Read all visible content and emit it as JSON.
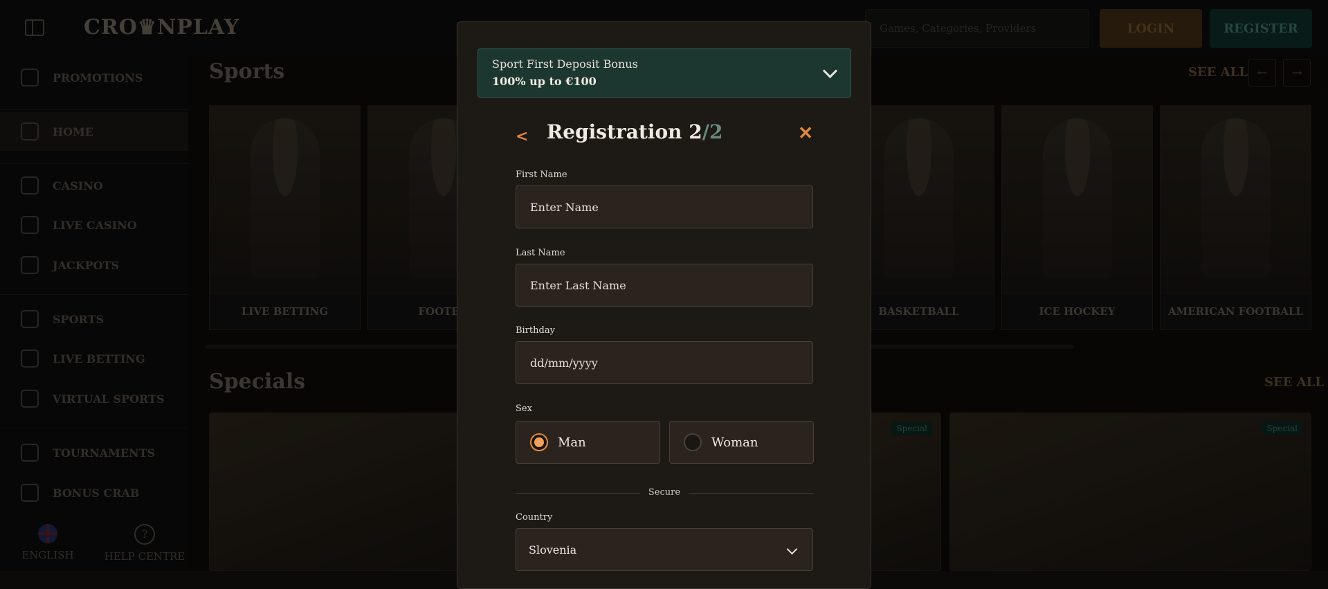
{
  "header": {
    "logo": "CRO♛NPLAY",
    "search_placeholder": "Games, Categories, Providers",
    "login_label": "LOGIN",
    "register_label": "REGISTER"
  },
  "sidebar": {
    "items": [
      {
        "label": "PROMOTIONS",
        "icon": "gift-icon"
      },
      {
        "label": "HOME",
        "icon": "home-icon"
      },
      {
        "label": "CASINO",
        "icon": "slot-machine-icon"
      },
      {
        "label": "LIVE CASINO",
        "icon": "spade-icon"
      },
      {
        "label": "JACKPOTS",
        "icon": "clover-icon"
      },
      {
        "label": "SPORTS",
        "icon": "soccer-ball-icon"
      },
      {
        "label": "LIVE BETTING",
        "icon": "live-icon"
      },
      {
        "label": "VIRTUAL SPORTS",
        "icon": "gamepad-icon"
      },
      {
        "label": "TOURNAMENTS",
        "icon": "trophy-icon"
      },
      {
        "label": "BONUS CRAB",
        "icon": "crab-icon"
      }
    ],
    "language": "ENGLISH",
    "help": "HELP CENTRE"
  },
  "sports": {
    "title": "Sports",
    "see_all": "SEE ALL",
    "cards": [
      "LIVE BETTING",
      "FOOTBA",
      "BASKETBALL",
      "ICE HOCKEY",
      "AMERICAN FOOTBALL"
    ]
  },
  "specials": {
    "title": "Specials",
    "see_all": "SEE ALL",
    "badge": "Special"
  },
  "modal": {
    "bonus_title": "Sport First Deposit Bonus",
    "bonus_subtitle": "100% up to €100",
    "reg_title": "Registration 2",
    "reg_total": "/2",
    "first_name_label": "First Name",
    "first_name_placeholder": "Enter Name",
    "last_name_label": "Last Name",
    "last_name_placeholder": "Enter Last Name",
    "birthday_label": "Birthday",
    "birthday_placeholder": "dd/mm/yyyy",
    "sex_label": "Sex",
    "sex_man": "Man",
    "sex_woman": "Woman",
    "sex_selected": "Man",
    "secure": "Secure",
    "country_label": "Country",
    "country_value": "Slovenia"
  }
}
